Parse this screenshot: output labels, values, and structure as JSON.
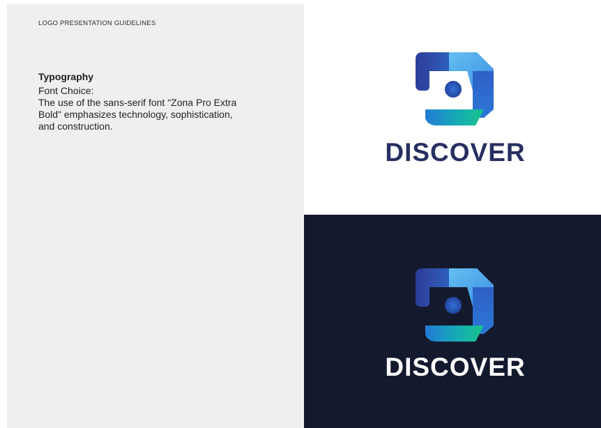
{
  "header": {
    "title": "LOGO PRESENTATION GUIDELINES"
  },
  "typography": {
    "heading": "Typography",
    "label": "Font Choice:",
    "body": "The use of the sans-serif font \"Zona Pro Extra Bold\" emphasizes technology, sophistication, and construction."
  },
  "logo": {
    "wordmark": "DISCOVER",
    "icon": "discover-logo-mark-icon",
    "colors": {
      "wordmark_dark": "#272f62",
      "wordmark_light": "#ffffff",
      "dark_background": "#141a2e",
      "blue": "#2e5fc0",
      "sky": "#5ab4ee",
      "teal": "#19c18e",
      "navy": "#2a3a8c"
    }
  }
}
